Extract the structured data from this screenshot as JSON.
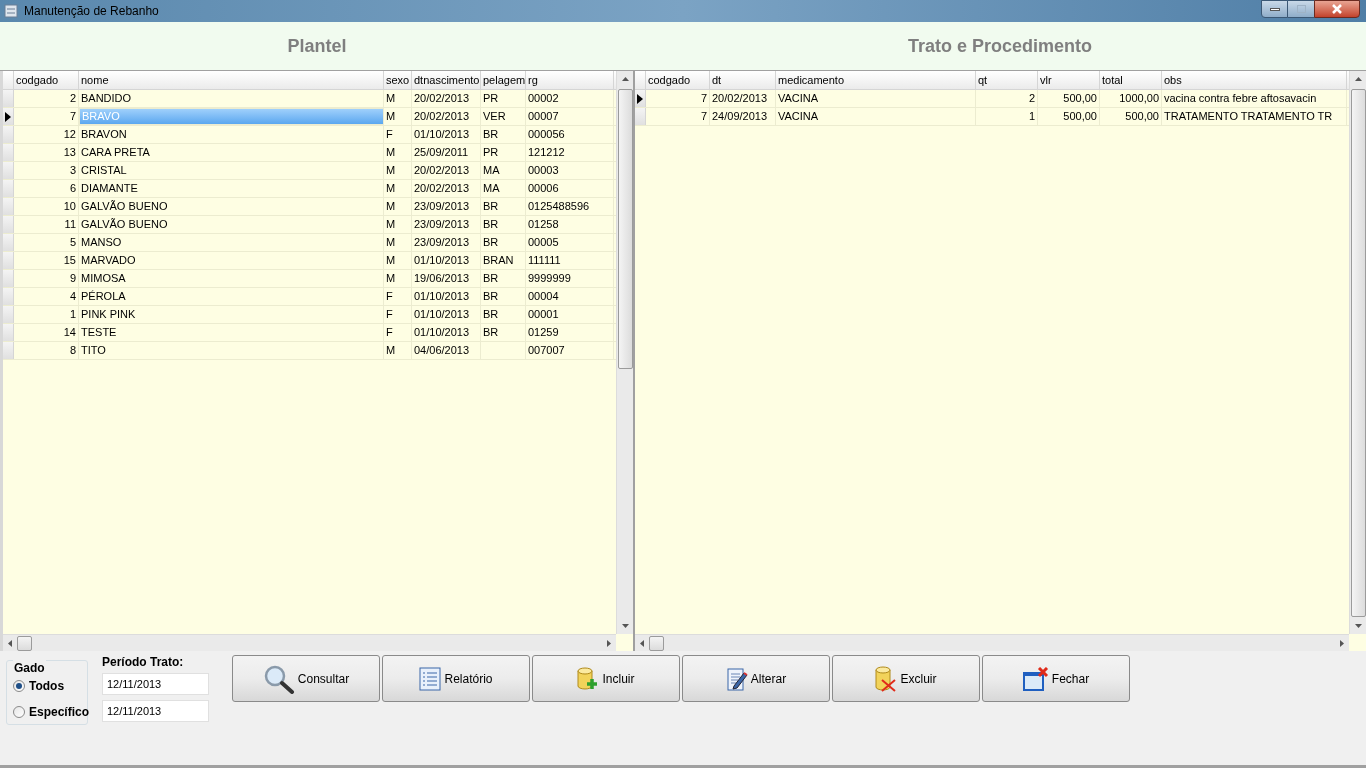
{
  "window": {
    "title": "Manutenção de Rebanho"
  },
  "plantel": {
    "title": "Plantel",
    "columns": [
      {
        "label": "codgado",
        "kind": "number"
      },
      {
        "label": "nome",
        "kind": "text"
      },
      {
        "label": "sexo",
        "kind": "text"
      },
      {
        "label": "dtnascimento",
        "kind": "text"
      },
      {
        "label": "pelagem",
        "kind": "text"
      },
      {
        "label": "rg",
        "kind": "text"
      }
    ],
    "rows": [
      {
        "selected": false,
        "cells": [
          "2",
          "BANDIDO",
          "M",
          "20/02/2013",
          "PR",
          "00002"
        ]
      },
      {
        "selected": true,
        "cells": [
          "7",
          "BRAVO",
          "M",
          "20/02/2013",
          "VER",
          "00007"
        ]
      },
      {
        "selected": false,
        "cells": [
          "12",
          "BRAVON",
          "F",
          "01/10/2013",
          "BR",
          "000056"
        ]
      },
      {
        "selected": false,
        "cells": [
          "13",
          "CARA PRETA",
          "M",
          "25/09/2011",
          "PR",
          "121212"
        ]
      },
      {
        "selected": false,
        "cells": [
          "3",
          "CRISTAL",
          "M",
          "20/02/2013",
          "MA",
          "00003"
        ]
      },
      {
        "selected": false,
        "cells": [
          "6",
          "DIAMANTE",
          "M",
          "20/02/2013",
          "MA",
          "00006"
        ]
      },
      {
        "selected": false,
        "cells": [
          "10",
          "GALVÃO BUENO",
          "M",
          "23/09/2013",
          "BR",
          "0125488596"
        ]
      },
      {
        "selected": false,
        "cells": [
          "11",
          "GALVÃO BUENO",
          "M",
          "23/09/2013",
          "BR",
          "01258"
        ]
      },
      {
        "selected": false,
        "cells": [
          "5",
          "MANSO",
          "M",
          "23/09/2013",
          "BR",
          "00005"
        ]
      },
      {
        "selected": false,
        "cells": [
          "15",
          "MARVADO",
          "M",
          "01/10/2013",
          "BRAN",
          "111111"
        ]
      },
      {
        "selected": false,
        "cells": [
          "9",
          "MIMOSA",
          "M",
          "19/06/2013",
          "BR",
          "9999999"
        ]
      },
      {
        "selected": false,
        "cells": [
          "4",
          "PÉROLA",
          "F",
          "01/10/2013",
          "BR",
          "00004"
        ]
      },
      {
        "selected": false,
        "cells": [
          "1",
          "PINK PINK",
          "F",
          "01/10/2013",
          "BR",
          "00001"
        ]
      },
      {
        "selected": false,
        "cells": [
          "14",
          "TESTE",
          "F",
          "01/10/2013",
          "BR",
          "01259"
        ]
      },
      {
        "selected": false,
        "cells": [
          "8",
          "TITO",
          "M",
          "04/06/2013",
          null,
          "007007"
        ]
      }
    ]
  },
  "trato": {
    "title": "Trato e Procedimento",
    "columns": [
      {
        "label": "codgado",
        "kind": "number"
      },
      {
        "label": "dt",
        "kind": "text"
      },
      {
        "label": "medicamento",
        "kind": "text"
      },
      {
        "label": "qt",
        "kind": "number"
      },
      {
        "label": "vlr",
        "kind": "number"
      },
      {
        "label": "total",
        "kind": "number"
      },
      {
        "label": "obs",
        "kind": "text"
      }
    ],
    "rows": [
      {
        "selected": true,
        "cells": [
          "7",
          "20/02/2013",
          "VACINA",
          "2",
          "500,00",
          "1000,00",
          "vacina contra febre aftosavacin"
        ]
      },
      {
        "selected": false,
        "cells": [
          "7",
          "24/09/2013",
          "VACINA",
          "1",
          "500,00",
          "500,00",
          "TRATAMENTO TRATAMENTO TR"
        ]
      }
    ]
  },
  "gado": {
    "title": "Gado",
    "options": [
      {
        "label": "Todos",
        "selected": true
      },
      {
        "label": "Específico",
        "selected": false
      }
    ]
  },
  "periodo": {
    "label": "Período Trato:",
    "from": "12/11/2013",
    "to": "12/11/2013"
  },
  "buttons": [
    {
      "label": "Consultar",
      "kind": "search"
    },
    {
      "label": "Relatório",
      "kind": "report"
    },
    {
      "label": "Incluir",
      "kind": "add"
    },
    {
      "label": "Alterar",
      "kind": "edit"
    },
    {
      "label": "Excluir",
      "kind": "delete"
    },
    {
      "label": "Fechar",
      "kind": "close"
    }
  ]
}
